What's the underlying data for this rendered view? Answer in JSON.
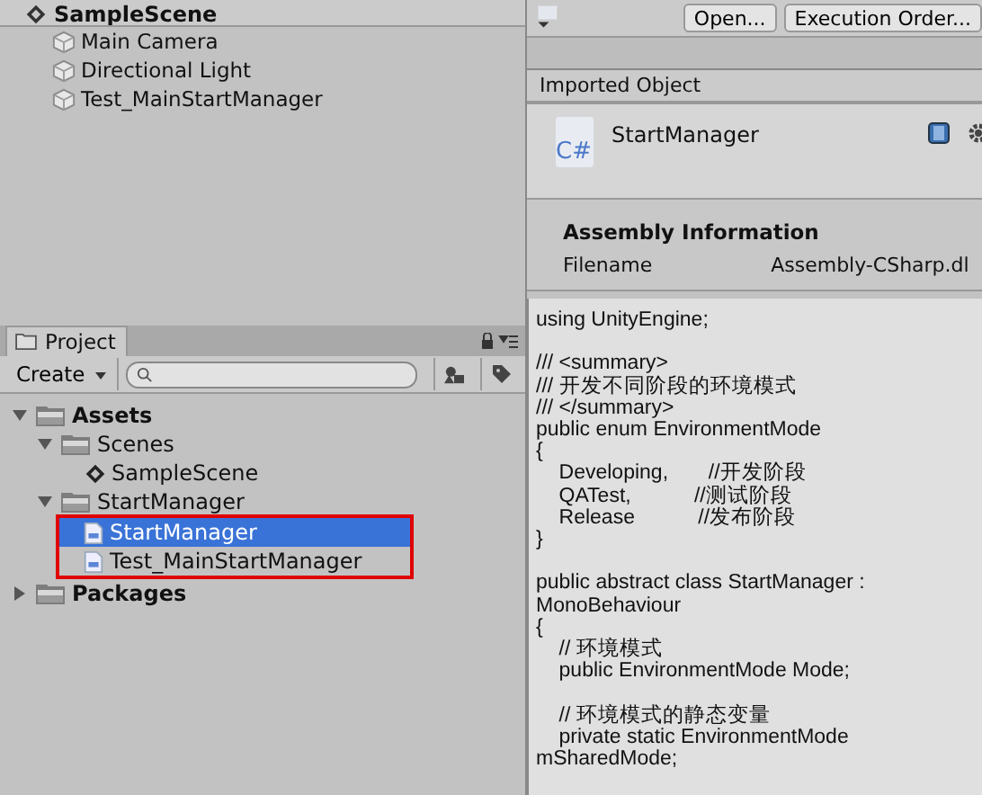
{
  "hierarchy": {
    "scene": "SampleScene",
    "items": [
      {
        "label": "Main Camera"
      },
      {
        "label": "Directional Light"
      },
      {
        "label": "Test_MainStartManager"
      }
    ]
  },
  "project": {
    "tab": "Project",
    "create": "Create",
    "tree": [
      {
        "label": "Assets",
        "kind": "folder",
        "expanded": true,
        "selected": false,
        "children": [
          {
            "label": "Scenes",
            "kind": "folder",
            "expanded": true,
            "selected": false,
            "children": [
              {
                "label": "SampleScene",
                "kind": "scene",
                "selected": false
              }
            ]
          },
          {
            "label": "StartManager",
            "kind": "folder",
            "expanded": true,
            "selected": false,
            "highlighted": true,
            "children": [
              {
                "label": "StartManager",
                "kind": "script",
                "selected": true
              },
              {
                "label": "Test_MainStartManager",
                "kind": "script",
                "selected": false
              }
            ]
          }
        ]
      },
      {
        "label": "Packages",
        "kind": "folder",
        "expanded": false,
        "selected": false
      }
    ]
  },
  "inspector": {
    "buttons": [
      "Open...",
      "Execution Order..."
    ],
    "section": "Imported Object",
    "asset": "StartManager",
    "icon_text": "C#",
    "assembly_title": "Assembly Information",
    "filename_label": "Filename",
    "filename": "Assembly-CSharp.dl",
    "code": "using UnityEngine;\n\n/// <summary>\n/// 开发不同阶段的环境模式\n/// </summary>\npublic enum EnvironmentMode\n{\n    Developing,       //开发阶段\n    QATest,           //测试阶段\n    Release           //发布阶段\n}\n\npublic abstract class StartManager :\nMonoBehaviour\n{\n    // 环境模式\n    public EnvironmentMode Mode;\n\n    // 环境模式的静态变量\n    private static EnvironmentMode\nmSharedMode;"
  }
}
